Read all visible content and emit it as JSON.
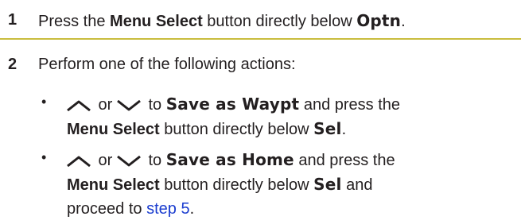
{
  "step1": {
    "number": "1",
    "text_a": "Press the ",
    "bold_a": "Menu Select",
    "text_b": " button directly below ",
    "lcd_a": "Optn",
    "text_c": "."
  },
  "step2": {
    "number": "2",
    "text": "Perform one of the following actions:"
  },
  "bullets": [
    {
      "marker": "•",
      "or": " or ",
      "to": " to ",
      "lcd_target": "Save as Waypt",
      "and_press": " and press the",
      "bold_menu": "Menu Select",
      "below": " button directly below ",
      "lcd_sel": "Sel",
      "end": "."
    },
    {
      "marker": "•",
      "or": " or ",
      "to": " to ",
      "lcd_target": "Save as Home",
      "and_press": " and press the",
      "bold_menu": "Menu Select",
      "below": " button directly below ",
      "lcd_sel": "Sel",
      "and": " and",
      "proceed": "proceed to ",
      "link": "step 5",
      "end": "."
    }
  ],
  "colors": {
    "text": "#231f20",
    "divider": "#c9bd3e",
    "link": "#1a3ccf"
  },
  "icons": [
    "chevron-up-icon",
    "chevron-down-icon"
  ]
}
